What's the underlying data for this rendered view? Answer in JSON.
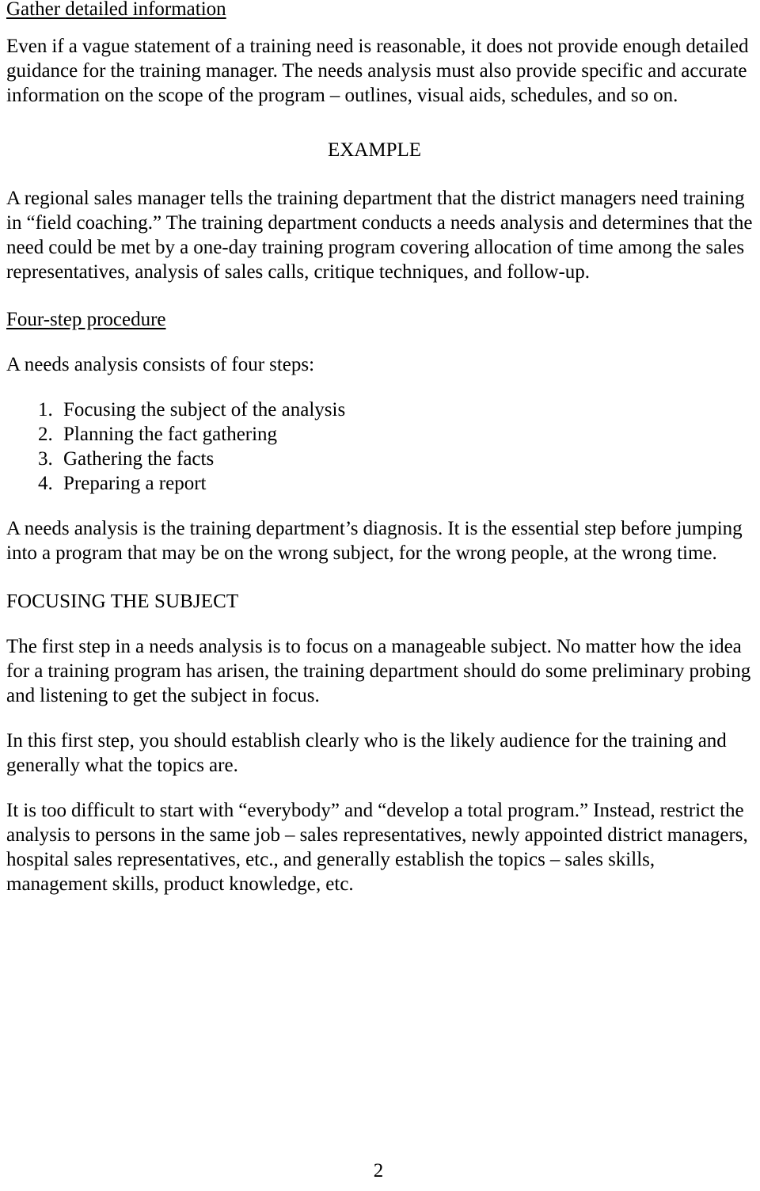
{
  "document": {
    "page_number": "2",
    "sections": [
      {
        "id": "gather-detailed-information",
        "heading": "Gather detailed information",
        "paragraph": "Even if a vague statement of a training need is reasonable, it does not provide enough detailed guidance for the training manager.  The needs analysis must also provide specific and accurate information on the scope of the program – outlines, visual aids, schedules, and so on."
      }
    ],
    "example": {
      "label": "EXAMPLE",
      "paragraph": "A regional sales manager tells the training department that the district managers need training in “field coaching.”  The training department conducts a needs analysis and determines that the need could be met by a one-day training program covering allocation of time among the sales representatives, analysis of sales calls, critique techniques, and follow-up."
    },
    "four_step": {
      "heading": "Four-step procedure",
      "intro": "A needs analysis consists of four steps:",
      "steps": [
        {
          "number": "1.",
          "text": "Focusing the subject of the analysis"
        },
        {
          "number": "2.",
          "text": "Planning the fact gathering"
        },
        {
          "number": "3.",
          "text": "Gathering the facts"
        },
        {
          "number": "4.",
          "text": "Preparing a report"
        }
      ],
      "closing": "A needs analysis is the training department’s diagnosis.  It is the essential step before jumping into a program that may be on the wrong subject, for the wrong people, at the wrong time."
    },
    "focusing_the_subject": {
      "heading": "FOCUSING THE SUBJECT",
      "paragraphs": [
        "The first step in a needs analysis is to focus on a manageable subject.  No matter how the idea for a training program has arisen, the training department should do some preliminary probing and listening to get the subject in focus.",
        "In this first step, you should establish clearly who is the likely audience for the training and generally what the topics are.",
        "It is too difficult to start with “everybody” and “develop a total program.”  Instead, restrict the analysis to persons in the same job – sales representatives, newly appointed district managers, hospital sales representatives, etc., and generally establish the topics – sales skills, management skills, product knowledge, etc."
      ]
    }
  }
}
